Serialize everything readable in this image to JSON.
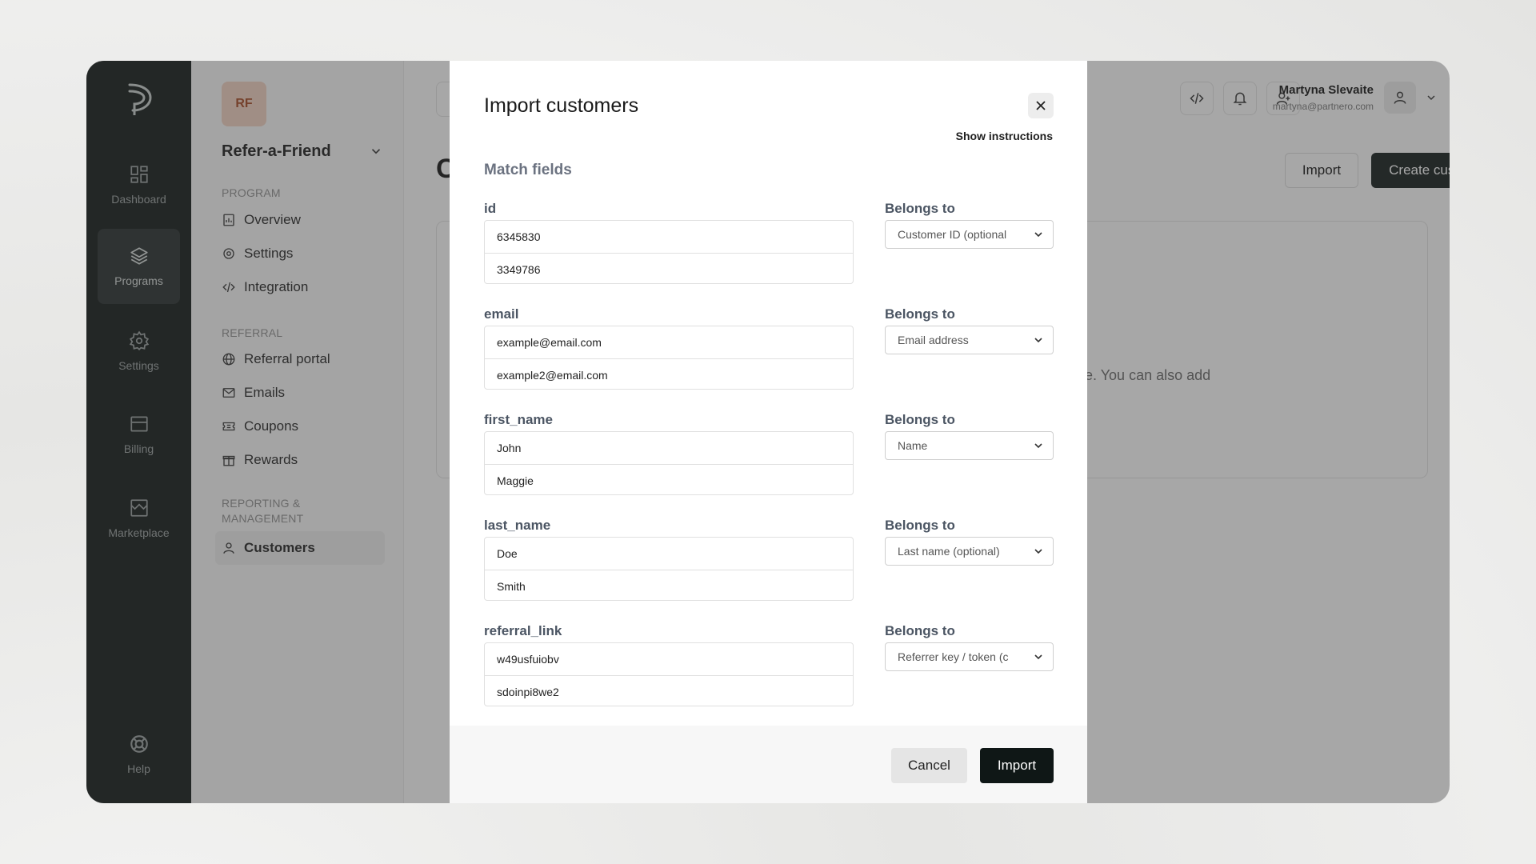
{
  "rail": {
    "items": [
      {
        "label": "Dashboard"
      },
      {
        "label": "Programs"
      },
      {
        "label": "Settings"
      },
      {
        "label": "Billing"
      },
      {
        "label": "Marketplace"
      },
      {
        "label": "Help"
      }
    ]
  },
  "sidebar": {
    "avatar_initials": "RF",
    "program_name": "Refer-a-Friend",
    "sections": {
      "program": "PROGRAM",
      "referral": "REFERRAL",
      "reporting": "REPORTING & MANAGEMENT"
    },
    "items": {
      "overview": "Overview",
      "settings": "Settings",
      "integration": "Integration",
      "referral_portal": "Referral portal",
      "emails": "Emails",
      "coupons": "Coupons",
      "rewards": "Rewards",
      "customers": "Customers"
    }
  },
  "header": {
    "page_title_partial": "C",
    "user_name": "Martyna Slevaite",
    "user_email": "martyna@partnero.com",
    "import_label": "Import",
    "create_label": "Create customer",
    "empty_text_partial": "e. You can also add"
  },
  "modal": {
    "title": "Import customers",
    "show_instructions": "Show instructions",
    "match_fields_title": "Match fields",
    "belongs_to_label": "Belongs to",
    "fields": [
      {
        "label": "id",
        "values": [
          "6345830",
          "3349786"
        ],
        "belongs_to": "Customer ID (optional"
      },
      {
        "label": "email",
        "values": [
          "example@email.com",
          "example2@email.com"
        ],
        "belongs_to": "Email address"
      },
      {
        "label": "first_name",
        "values": [
          "John",
          "Maggie"
        ],
        "belongs_to": "Name"
      },
      {
        "label": "last_name",
        "values": [
          "Doe",
          "Smith"
        ],
        "belongs_to": "Last name (optional)"
      },
      {
        "label": "referral_link",
        "values": [
          "w49usfuiobv",
          "sdoinpi8we2"
        ],
        "belongs_to": "Referrer key / token (c"
      }
    ],
    "cancel_label": "Cancel",
    "import_label": "Import"
  }
}
